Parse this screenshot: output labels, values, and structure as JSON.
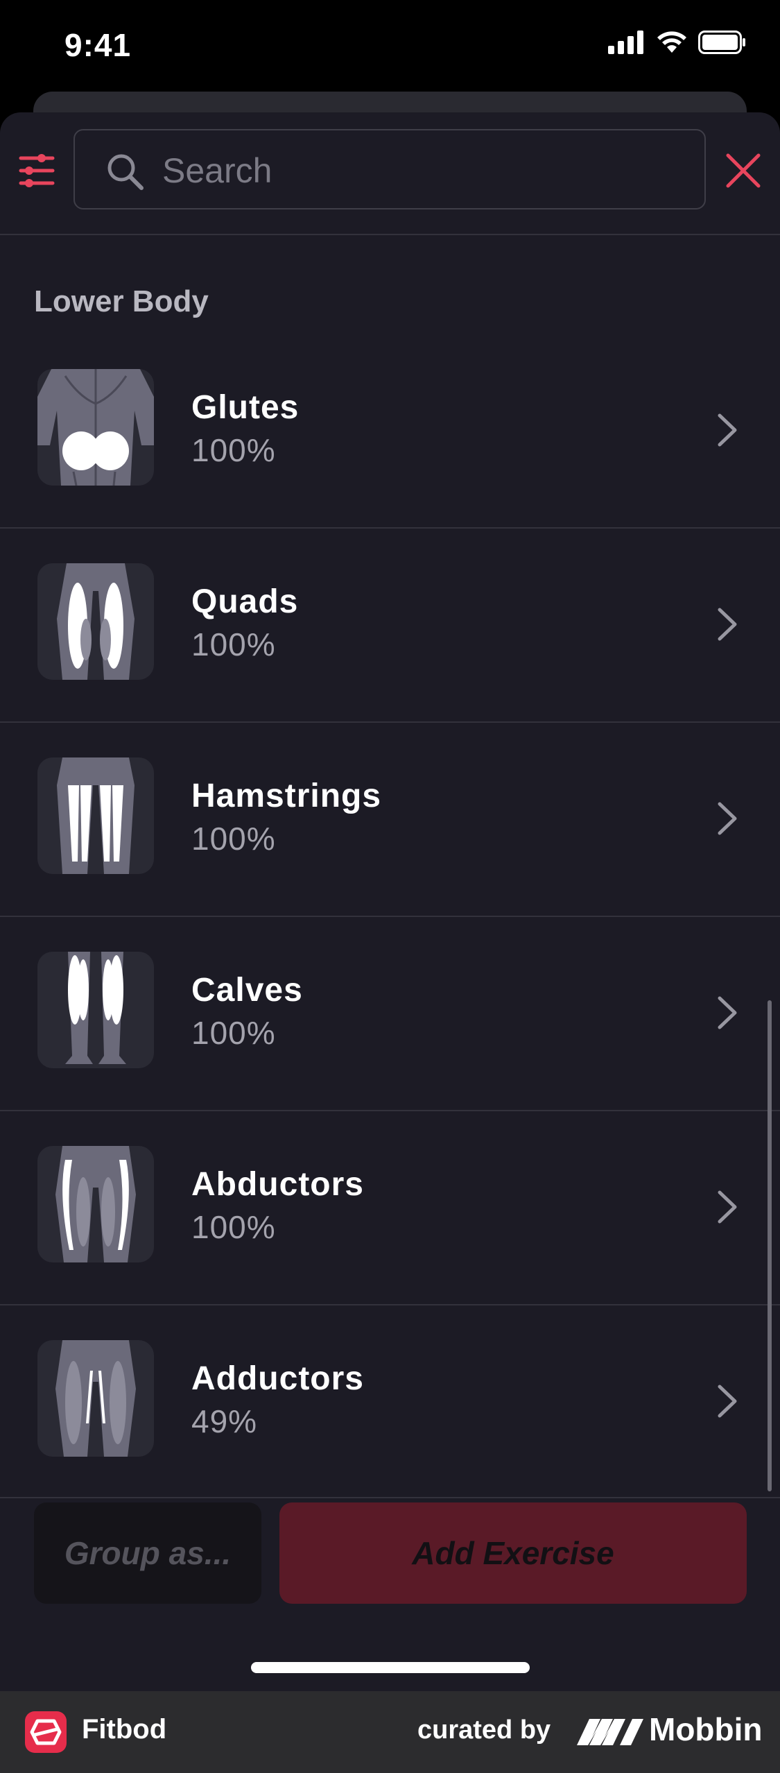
{
  "status_bar": {
    "time": "9:41"
  },
  "search": {
    "placeholder": "Search"
  },
  "section": {
    "title": "Lower Body"
  },
  "muscles": [
    {
      "name": "Glutes",
      "pct": "100%",
      "icon": "glutes-figure"
    },
    {
      "name": "Quads",
      "pct": "100%",
      "icon": "quads-figure"
    },
    {
      "name": "Hamstrings",
      "pct": "100%",
      "icon": "hamstrings-figure"
    },
    {
      "name": "Calves",
      "pct": "100%",
      "icon": "calves-figure"
    },
    {
      "name": "Abductors",
      "pct": "100%",
      "icon": "abductors-figure"
    },
    {
      "name": "Adductors",
      "pct": "49%",
      "icon": "adductors-figure"
    }
  ],
  "actions": {
    "group_label": "Group as...",
    "add_label": "Add Exercise"
  },
  "footer": {
    "app_name": "Fitbod",
    "curated_by": "curated by",
    "brand": "Mobbin"
  },
  "colors": {
    "accent": "#e8455d",
    "background": "#1c1b25",
    "add_button": "#5a1a27"
  }
}
